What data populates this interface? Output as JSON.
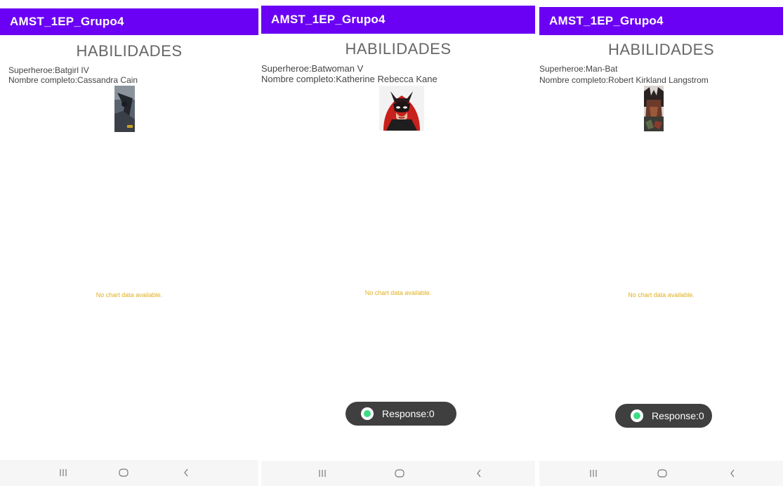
{
  "screens": [
    {
      "app_title": "AMST_1EP_Grupo4",
      "heading": "HABILIDADES",
      "superhero_line": "Superheroe:Batgirl IV",
      "fullname_line": "Nombre completo:Cassandra Cain",
      "no_chart_text": "No chart data available."
    },
    {
      "app_title": "AMST_1EP_Grupo4",
      "heading": "HABILIDADES",
      "superhero_line": "Superheroe:Batwoman V",
      "fullname_line": "Nombre completo:Katherine Rebecca Kane",
      "no_chart_text": "No chart data available.",
      "toast_text": "Response:0"
    },
    {
      "app_title": "AMST_1EP_Grupo4",
      "heading": "HABILIDADES",
      "superhero_line": "Superheroe:Man-Bat",
      "fullname_line": "Nombre completo:Robert Kirkland Langstrom",
      "no_chart_text": "No chart data available.",
      "toast_text": "Response:0"
    }
  ],
  "icons": {
    "nav_recents": "recent-apps-icon",
    "nav_home": "home-icon",
    "nav_back": "back-icon",
    "toast": "android-app-icon"
  },
  "colors": {
    "appbar": "#6a00f4",
    "no_chart_text": "#e0b020",
    "toast_bg": "#3f3f3f"
  }
}
